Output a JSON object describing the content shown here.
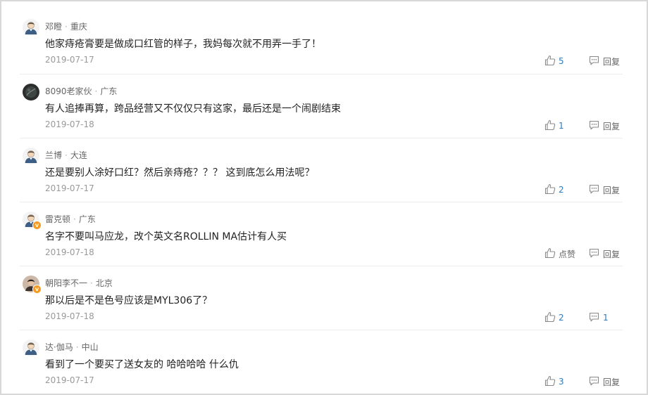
{
  "comments": [
    {
      "user": "邓瞪",
      "location": "重庆",
      "text": "他家痔疮膏要是做成口红管的样子，我妈每次就不用弄一手了！",
      "date": "2019-07-17",
      "likes": "5",
      "reply": "回复",
      "avatar": "default",
      "verified": false
    },
    {
      "user": "8090老家伙",
      "location": "广东",
      "text": "有人追捧再算，跨品经营又不仅仅只有这家，最后还是一个闹剧结束",
      "date": "2019-07-18",
      "likes": "1",
      "reply": "回复",
      "avatar": "photo-dark",
      "verified": false
    },
    {
      "user": "兰博",
      "location": "大连",
      "text": "还是要别人涂好口红？然后亲痔疮？？？  这到底怎么用法呢？",
      "date": "2019-07-17",
      "likes": "2",
      "reply": "回复",
      "avatar": "default",
      "verified": false
    },
    {
      "user": "雷克顿",
      "location": "广东",
      "text": "名字不要叫马应龙，改个英文名ROLLIN MA估计有人买",
      "date": "2019-07-18",
      "likes": "点赞",
      "reply": "回复",
      "avatar": "default",
      "verified": true
    },
    {
      "user": "朝阳李不一",
      "location": "北京",
      "text": "那以后是不是色号应该是MYL306了？",
      "date": "2019-07-18",
      "likes": "2",
      "reply": "1",
      "avatar": "photo-person",
      "verified": true
    },
    {
      "user": "达·伽马",
      "location": "中山",
      "text": "看到了一个要买了送女友的 哈哈哈哈 什么仇",
      "date": "2019-07-17",
      "likes": "3",
      "reply": "回复",
      "avatar": "default",
      "verified": false
    }
  ],
  "separator": "·",
  "colors": {
    "accent": "#2e7bbf",
    "verified_badge": "#f59b23"
  }
}
